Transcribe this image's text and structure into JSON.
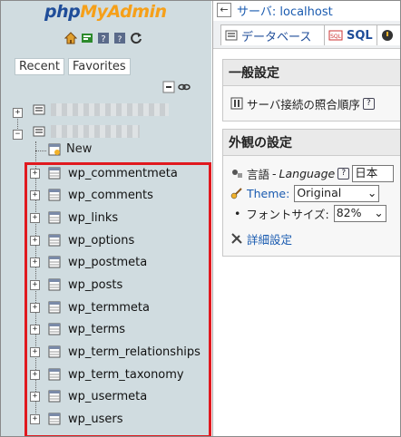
{
  "logo": {
    "part1": "php",
    "part2": "MyAdmin"
  },
  "nav": {
    "icons": [
      "home-icon",
      "logout-icon",
      "query-icon",
      "docs-icon",
      "reload-icon"
    ],
    "tabs": {
      "recent": "Recent",
      "favorites": "Favorites"
    },
    "new_label": "New",
    "tables": [
      "wp_commentmeta",
      "wp_comments",
      "wp_links",
      "wp_options",
      "wp_postmeta",
      "wp_posts",
      "wp_termmeta",
      "wp_terms",
      "wp_term_relationships",
      "wp_term_taxonomy",
      "wp_usermeta",
      "wp_users"
    ],
    "highlight_color": "#e0191f"
  },
  "header": {
    "server_label": "サーバ: localhost"
  },
  "menu": {
    "databases": "データベース",
    "sql": "SQL"
  },
  "general": {
    "title": "一般設定",
    "collation_label": "サーバ接続の照合順序"
  },
  "appearance": {
    "title": "外観の設定",
    "language_label": "言語",
    "language_en": "Language",
    "language_value": "日本",
    "theme_label": "Theme:",
    "theme_value": "Original",
    "fontsize_label": "フォントサイズ:",
    "fontsize_value": "82%",
    "more_settings": "詳細設定"
  }
}
